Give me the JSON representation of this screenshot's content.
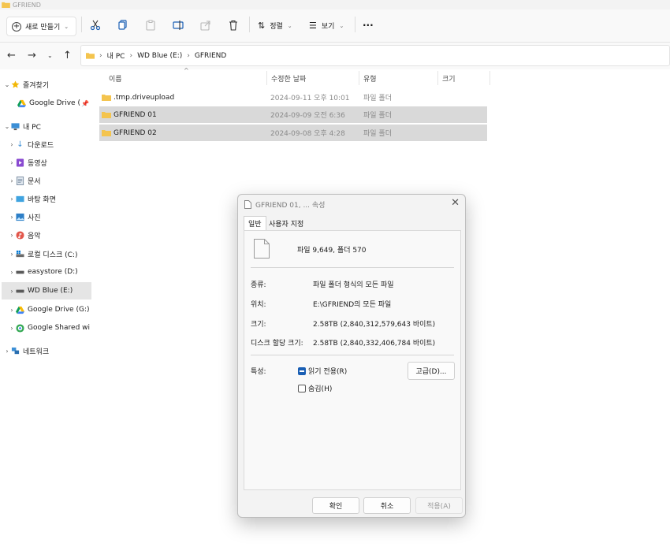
{
  "window": {
    "title": "GFRIEND"
  },
  "toolbar": {
    "new_label": "새로 만들기",
    "sort_label": "정렬",
    "view_label": "보기",
    "more_label": "···"
  },
  "breadcrumb": {
    "items": [
      "내 PC",
      "WD Blue (E:)",
      "GFRIEND"
    ]
  },
  "sidebar": {
    "items": [
      {
        "label": "즐겨찾기",
        "icon": "star-icon",
        "color": "#f2b705"
      },
      {
        "label": "Google Drive (",
        "icon": "google-drive-icon"
      },
      {
        "label": "내 PC",
        "icon": "pc-icon",
        "color": "#3c8fd6"
      },
      {
        "label": "다운로드",
        "icon": "download-icon",
        "color": "#3c8fd6"
      },
      {
        "label": "동영상",
        "icon": "video-icon",
        "color": "#8a4bd1"
      },
      {
        "label": "문서",
        "icon": "document-icon",
        "color": "#7d8fa3"
      },
      {
        "label": "바탕 화면",
        "icon": "desktop-icon",
        "color": "#3fa3e0"
      },
      {
        "label": "사진",
        "icon": "photo-icon",
        "color": "#2d7fc7"
      },
      {
        "label": "음악",
        "icon": "music-icon",
        "color": "#e2574c"
      },
      {
        "label": "로컬 디스크 (C:)",
        "icon": "windows-drive-icon"
      },
      {
        "label": "easystore (D:)",
        "icon": "drive-icon"
      },
      {
        "label": "WD Blue (E:)",
        "icon": "drive-icon"
      },
      {
        "label": "Google Drive (G:)",
        "icon": "google-drive-icon"
      },
      {
        "label": "Google Shared wi",
        "icon": "google-shared-icon"
      },
      {
        "label": "네트워크",
        "icon": "network-icon",
        "color": "#3c8fd6"
      }
    ]
  },
  "columns": {
    "name": "이름",
    "date": "수정한 날짜",
    "type": "유형",
    "size": "크기"
  },
  "files": [
    {
      "name": ".tmp.driveupload",
      "date": "2024-09-11 오후 10:01",
      "type": "파일 폴더"
    },
    {
      "name": "GFRIEND 01",
      "date": "2024-09-09 오전 6:36",
      "type": "파일 폴더"
    },
    {
      "name": "GFRIEND 02",
      "date": "2024-09-08 오후 4:28",
      "type": "파일 폴더"
    }
  ],
  "dialog": {
    "title": "GFRIEND 01, ... 속성",
    "tabs": [
      "일반",
      "사용자 지정"
    ],
    "summary": "파일 9,649, 폴더 570",
    "kind_label": "종류:",
    "kind_value": "파일 폴더 형식의 모든 파일",
    "location_label": "위치:",
    "location_value": "E:\\GFRIEND의 모든 파일",
    "size_label": "크기:",
    "size_value": "2.58TB (2,840,312,579,643 바이트)",
    "disk_label": "디스크 할당 크기:",
    "disk_value": "2.58TB (2,840,332,406,784 바이트)",
    "attr_label": "특성:",
    "readonly_label": "읽기 전용(R)",
    "hidden_label": "숨김(H)",
    "advanced_label": "고급(D)...",
    "ok_label": "확인",
    "cancel_label": "취소",
    "apply_label": "적용(A)"
  }
}
